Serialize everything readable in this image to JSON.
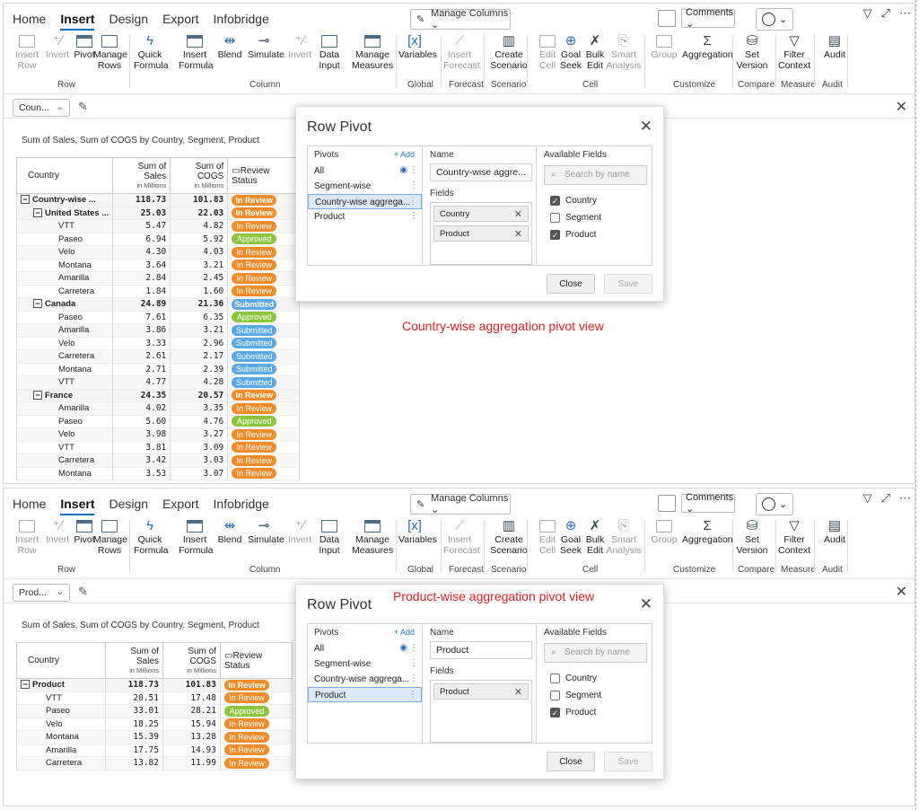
{
  "tabs": [
    "Home",
    "Insert",
    "Design",
    "Export",
    "Infobridge"
  ],
  "active_tab": "Insert",
  "manage_columns": "Manage Columns",
  "comments": "Comments",
  "ribbon": {
    "insert_row": "Insert Row",
    "invert1": "Invert",
    "pivot": "Pivot",
    "manage_rows": "Manage Rows",
    "quick_formula": "Quick Formula",
    "insert_formula": "Insert Formula",
    "blend": "Blend",
    "simulate": "Simulate",
    "invert2": "Invert",
    "data_input": "Data Input",
    "manage_measures": "Manage Measures",
    "variables": "Variables",
    "insert_forecast": "Insert Forecast",
    "create_scenario": "Create Scenario",
    "edit_cell": "Edit Cell",
    "goal_seek": "Goal Seek",
    "bulk_edit": "Bulk Edit",
    "smart_analysis": "Smart Analysis",
    "group": "Group",
    "aggregation": "Aggregation",
    "set_version": "Set Version",
    "filter_context": "Filter Context",
    "audit": "Audit",
    "groups": {
      "row": "Row",
      "column": "Column",
      "global": "Global",
      "forecast": "Forecast",
      "scenario": "Scenario",
      "cell": "Cell",
      "customize": "Customize",
      "compare": "Compare",
      "measure": "Measure",
      "audit": "Audit"
    }
  },
  "report_title": "Sum of Sales, Sum of COGS by Country, Segment, Product",
  "table_headers": {
    "country": "Country",
    "sales": "Sum of Sales",
    "cogs": "Sum of COGS",
    "units": "in Millions",
    "status": "Review Status"
  },
  "view1": {
    "dropdown": "Coun...",
    "rows": [
      {
        "label": "Country-wise ...",
        "sales": "118.73",
        "cogs": "101.83",
        "status": "In Review",
        "level": 0,
        "bold": true,
        "toggle": "⊟"
      },
      {
        "label": "United States ...",
        "sales": "25.03",
        "cogs": "22.03",
        "status": "In Review",
        "level": 1,
        "bold": true,
        "toggle": "⊟"
      },
      {
        "label": "VTT",
        "sales": "5.47",
        "cogs": "4.82",
        "status": "In Review",
        "level": 2
      },
      {
        "label": "Paseo",
        "sales": "6.94",
        "cogs": "5.92",
        "status": "Approved",
        "level": 2
      },
      {
        "label": "Velo",
        "sales": "4.30",
        "cogs": "4.03",
        "status": "In Review",
        "level": 2
      },
      {
        "label": "Montana",
        "sales": "3.64",
        "cogs": "3.21",
        "status": "In Review",
        "level": 2
      },
      {
        "label": "Amarilla",
        "sales": "2.84",
        "cogs": "2.45",
        "status": "In Review",
        "level": 2
      },
      {
        "label": "Carretera",
        "sales": "1.84",
        "cogs": "1.60",
        "status": "In Review",
        "level": 2
      },
      {
        "label": "Canada",
        "sales": "24.89",
        "cogs": "21.36",
        "status": "Submitted",
        "level": 1,
        "bold": true,
        "toggle": "⊟"
      },
      {
        "label": "Paseo",
        "sales": "7.61",
        "cogs": "6.35",
        "status": "Approved",
        "level": 2
      },
      {
        "label": "Amarilla",
        "sales": "3.86",
        "cogs": "3.21",
        "status": "Submitted",
        "level": 2
      },
      {
        "label": "Velo",
        "sales": "3.33",
        "cogs": "2.96",
        "status": "Submitted",
        "level": 2
      },
      {
        "label": "Carretera",
        "sales": "2.61",
        "cogs": "2.17",
        "status": "Submitted",
        "level": 2
      },
      {
        "label": "Montana",
        "sales": "2.71",
        "cogs": "2.39",
        "status": "Submitted",
        "level": 2
      },
      {
        "label": "VTT",
        "sales": "4.77",
        "cogs": "4.28",
        "status": "Submitted",
        "level": 2
      },
      {
        "label": "France",
        "sales": "24.35",
        "cogs": "20.57",
        "status": "In Review",
        "level": 1,
        "bold": true,
        "toggle": "⊟"
      },
      {
        "label": "Amarilla",
        "sales": "4.02",
        "cogs": "3.35",
        "status": "In Review",
        "level": 2
      },
      {
        "label": "Paseo",
        "sales": "5.60",
        "cogs": "4.76",
        "status": "Approved",
        "level": 2
      },
      {
        "label": "Velo",
        "sales": "3.98",
        "cogs": "3.27",
        "status": "In Review",
        "level": 2
      },
      {
        "label": "VTT",
        "sales": "3.81",
        "cogs": "3.09",
        "status": "In Review",
        "level": 2
      },
      {
        "label": "Carretera",
        "sales": "3.42",
        "cogs": "3.03",
        "status": "In Review",
        "level": 2
      },
      {
        "label": "Montana",
        "sales": "3.53",
        "cogs": "3.07",
        "status": "In Review",
        "level": 2
      }
    ],
    "dialog": {
      "title": "Row Pivot",
      "pivots_label": "Pivots",
      "add_label": "+ Add",
      "pivots": [
        "All",
        "Segment-wise",
        "Country-wise aggrega...",
        "Product"
      ],
      "selected": 2,
      "name_label": "Name",
      "name_value": "Country-wise aggre...",
      "fields_label": "Fields",
      "fields": [
        "Country",
        "Product"
      ],
      "available_label": "Available Fields",
      "search_placeholder": "Search by name",
      "available": [
        {
          "name": "Country",
          "checked": true
        },
        {
          "name": "Segment",
          "checked": false
        },
        {
          "name": "Product",
          "checked": true
        }
      ],
      "close": "Close",
      "save": "Save"
    },
    "caption": "Country-wise aggregation pivot view"
  },
  "view2": {
    "dropdown": "Prod...",
    "rows": [
      {
        "label": "Product",
        "sales": "118.73",
        "cogs": "101.83",
        "status": "In Review",
        "level": 0,
        "bold": true,
        "toggle": "⊟"
      },
      {
        "label": "VTT",
        "sales": "20.51",
        "cogs": "17.48",
        "status": "In Review",
        "level": 1
      },
      {
        "label": "Paseo",
        "sales": "33.01",
        "cogs": "28.21",
        "status": "Approved",
        "level": 1
      },
      {
        "label": "Velo",
        "sales": "18.25",
        "cogs": "15.94",
        "status": "In Review",
        "level": 1
      },
      {
        "label": "Montana",
        "sales": "15.39",
        "cogs": "13.28",
        "status": "In Review",
        "level": 1
      },
      {
        "label": "Amarilla",
        "sales": "17.75",
        "cogs": "14.93",
        "status": "In Review",
        "level": 1
      },
      {
        "label": "Carretera",
        "sales": "13.82",
        "cogs": "11.99",
        "status": "In Review",
        "level": 1
      }
    ],
    "dialog": {
      "title": "Row Pivot",
      "pivots_label": "Pivots",
      "add_label": "+ Add",
      "pivots": [
        "All",
        "Segment-wise",
        "Country-wise aggrega...",
        "Product"
      ],
      "selected": 3,
      "name_label": "Name",
      "name_value": "Product",
      "fields_label": "Fields",
      "fields": [
        "Product"
      ],
      "available_label": "Available Fields",
      "search_placeholder": "Search by name",
      "available": [
        {
          "name": "Country",
          "checked": false
        },
        {
          "name": "Segment",
          "checked": false
        },
        {
          "name": "Product",
          "checked": true
        }
      ],
      "close": "Close",
      "save": "Save"
    },
    "caption": "Product-wise aggregation pivot view"
  },
  "colors": {
    "in_review": "#f28c28",
    "approved": "#8cc63f",
    "submitted": "#5aa9e6",
    "caption": "#e02020",
    "accent": "#0070c0"
  }
}
